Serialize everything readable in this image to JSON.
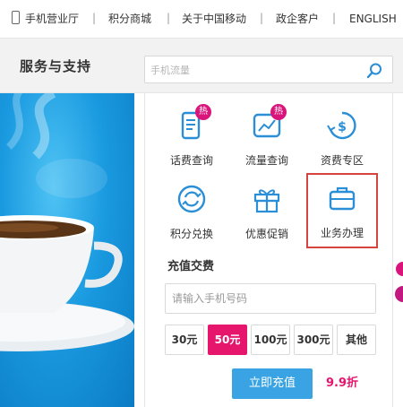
{
  "topnav": {
    "items": [
      "手机营业厅",
      "积分商城",
      "关于中国移动",
      "政企客户",
      "ENGLISH"
    ]
  },
  "service": {
    "title": "服务与支持",
    "search_placeholder": "手机流量"
  },
  "panel": {
    "tiles": [
      {
        "label": "话费查询",
        "icon": "phone-bill-icon",
        "hot": "热"
      },
      {
        "label": "流量查询",
        "icon": "data-chart-icon",
        "hot": "热"
      },
      {
        "label": "资费专区",
        "icon": "price-icon"
      },
      {
        "label": "积分兑换",
        "icon": "refresh-icon"
      },
      {
        "label": "优惠促销",
        "icon": "gift-icon"
      },
      {
        "label": "业务办理",
        "icon": "briefcase-icon"
      }
    ],
    "selected_tile": "业务办理",
    "recharge_title": "充值交费",
    "phone_placeholder": "请输入手机号码",
    "amounts": [
      "30元",
      "50元",
      "100元",
      "300元",
      "其他"
    ],
    "active_amount": "50元",
    "submit_label": "立即充值",
    "discount": "9.9折"
  },
  "colors": {
    "accent_blue": "#3aa3e3",
    "accent_pink": "#e6166d",
    "hot_badge": "#d9157b",
    "selected_border": "#d6443f"
  }
}
